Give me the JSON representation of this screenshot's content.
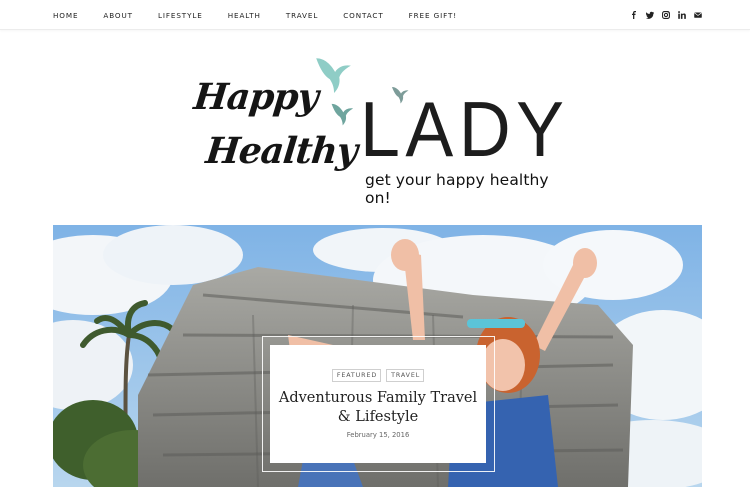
{
  "nav": {
    "items": [
      {
        "label": "HOME"
      },
      {
        "label": "ABOUT"
      },
      {
        "label": "LIFESTYLE"
      },
      {
        "label": "HEALTH"
      },
      {
        "label": "TRAVEL"
      },
      {
        "label": "CONTACT"
      },
      {
        "label": "FREE GIFT!"
      }
    ]
  },
  "social": {
    "icons": [
      "facebook-icon",
      "twitter-icon",
      "instagram-icon",
      "linkedin-icon",
      "email-icon"
    ]
  },
  "logo": {
    "script_line1": "Happy",
    "script_line2": "Healthy",
    "wordmark": "LADY",
    "tagline": "get your happy healthy on!",
    "bird_colors": [
      "#8fcdc6",
      "#6fa59e",
      "#7d9c99"
    ]
  },
  "featured_post": {
    "tags": [
      "FEATURED",
      "TRAVEL"
    ],
    "title": "Adventurous Family Travel & Lifestyle",
    "date": "February 15, 2016"
  },
  "colors": {
    "background": "#ffffff",
    "text": "#222222",
    "accent_bird": "#8fcdc6"
  }
}
